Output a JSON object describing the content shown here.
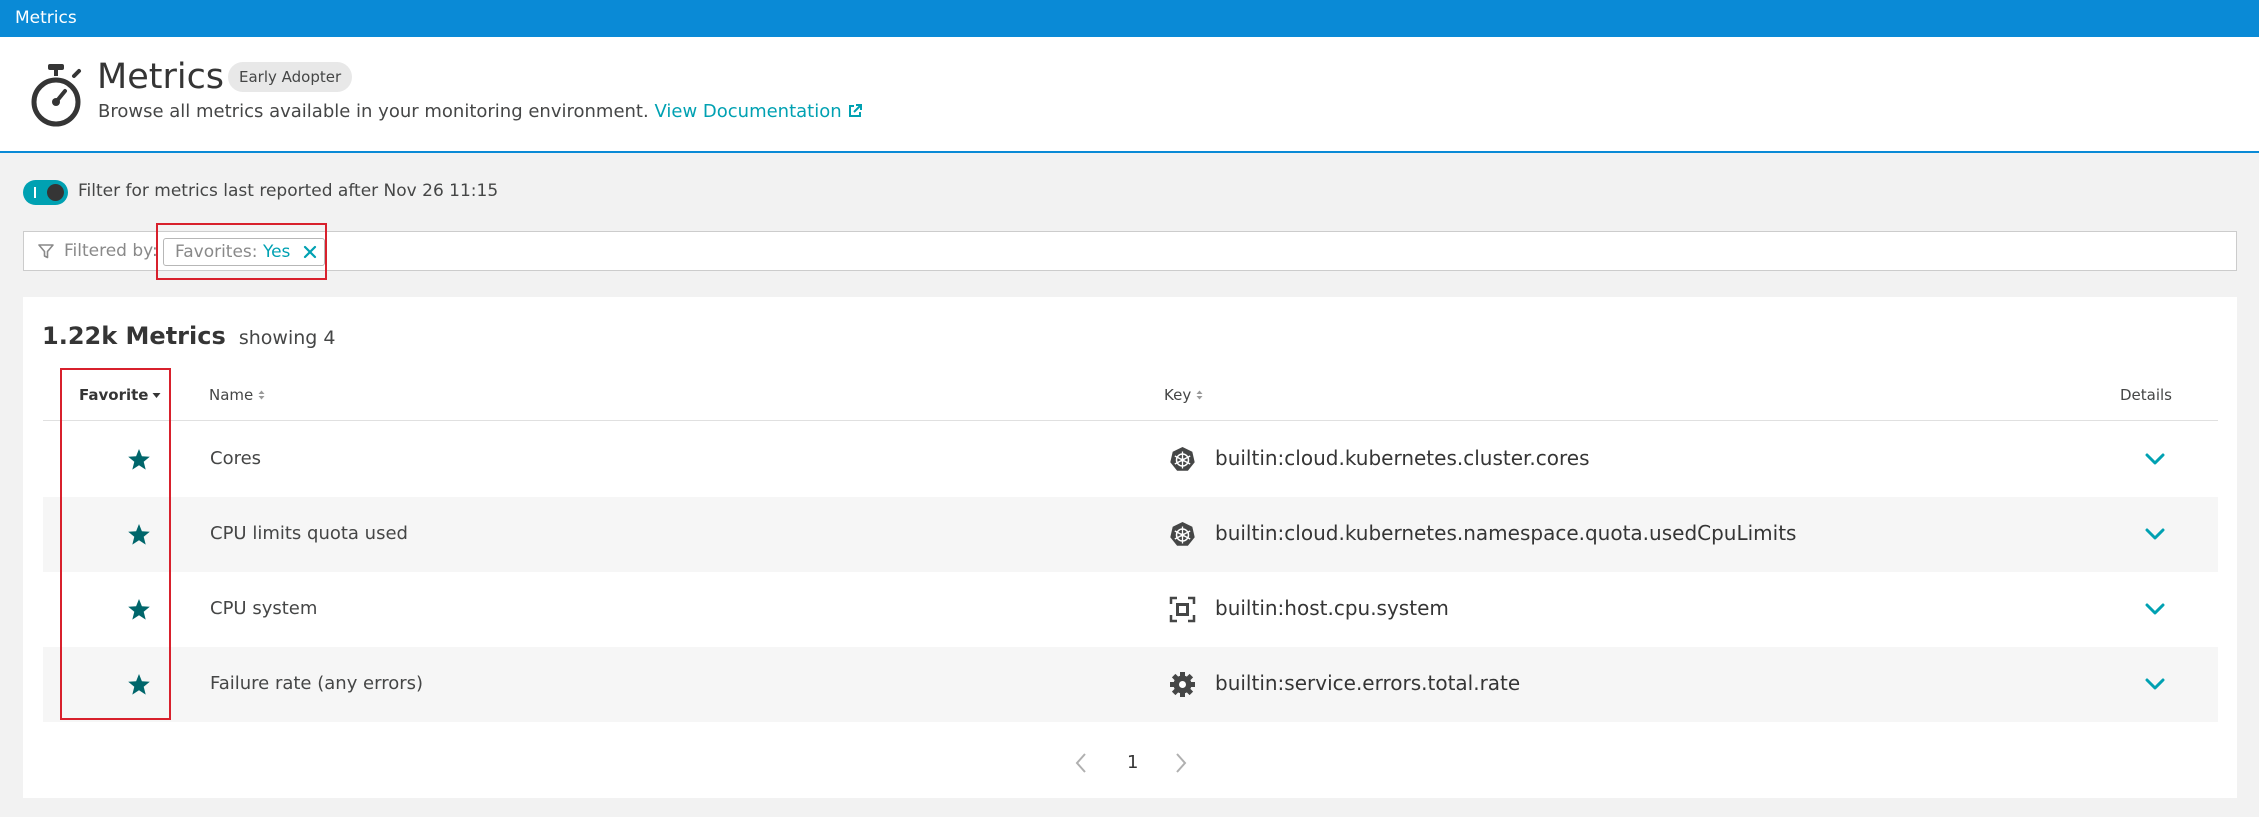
{
  "topbar": {
    "title": "Metrics"
  },
  "header": {
    "title": "Metrics",
    "badge": "Early Adopter",
    "description": "Browse all metrics available in your monitoring environment.",
    "doc_link": "View Documentation"
  },
  "toggle": {
    "label": "Filter for metrics last reported after Nov 26 11:15",
    "on": true
  },
  "filter": {
    "label": "Filtered by:",
    "chip_key": "Favorites:",
    "chip_value": "Yes"
  },
  "summary": {
    "count": "1.22k Metrics",
    "showing": "showing 4"
  },
  "table": {
    "columns": {
      "favorite": "Favorite",
      "name": "Name",
      "key": "Key",
      "details": "Details"
    },
    "rows": [
      {
        "name": "Cores",
        "key": "builtin:cloud.kubernetes.cluster.cores",
        "icon": "kubernetes-icon",
        "favorite": true
      },
      {
        "name": "CPU limits quota used",
        "key": "builtin:cloud.kubernetes.namespace.quota.usedCpuLimits",
        "icon": "kubernetes-icon",
        "favorite": true
      },
      {
        "name": "CPU system",
        "key": "builtin:host.cpu.system",
        "icon": "host-icon",
        "favorite": true
      },
      {
        "name": "Failure rate (any errors)",
        "key": "builtin:service.errors.total.rate",
        "icon": "service-gear-icon",
        "favorite": true
      }
    ]
  },
  "pagination": {
    "current_page": "1"
  },
  "colors": {
    "brand": "#0a8ad6",
    "accent": "#00a1b2",
    "favorite": "#00666b",
    "highlight": "#d8202c"
  }
}
